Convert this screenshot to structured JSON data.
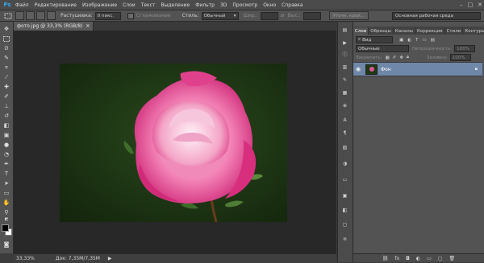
{
  "app": {
    "logo": "Ps"
  },
  "menu": [
    "Файл",
    "Редактирование",
    "Изображение",
    "Слои",
    "Текст",
    "Выделение",
    "Фильтр",
    "3D",
    "Просмотр",
    "Окно",
    "Справка"
  ],
  "window_controls": [
    "–",
    "□",
    "✕"
  ],
  "options": {
    "feather_label": "Растушевка:",
    "feather_value": "0 пикс.",
    "antialias_label": "Сглаживание",
    "style_label": "Стиль:",
    "style_value": "Обычный",
    "width_label": "Шир.:",
    "height_label": "Выс.:",
    "refine_edge": "Уточн. край...",
    "workspace": "Основная рабочая среда"
  },
  "document": {
    "tab_title": "фото.jpg @ 33,3% (RGB/8)",
    "close_glyph": "✕"
  },
  "status": {
    "zoom": "33,33%",
    "doc_info": "Док: 7,35M/7,35M",
    "arrow": "▶"
  },
  "panel": {
    "tabs": [
      "Слои",
      "Образцы",
      "Каналы",
      "Коррекция",
      "Стили",
      "Контуры"
    ],
    "kind_label": "Вид",
    "blend_mode": "Обычные",
    "opacity_label": "Непрозрачность:",
    "opacity_value": "100%",
    "lock_label": "Закрепить:",
    "fill_label": "Заливка:",
    "fill_value": "100%",
    "layers": [
      {
        "name": "Фон"
      }
    ],
    "bottom_icons": [
      "link-icon",
      "fx-icon",
      "mask-icon",
      "adjustment-icon",
      "folder-icon",
      "new-layer-icon",
      "trash-icon"
    ]
  },
  "colors": {
    "accent": "#35a8e8",
    "layer_selected": "#6f87a8"
  }
}
